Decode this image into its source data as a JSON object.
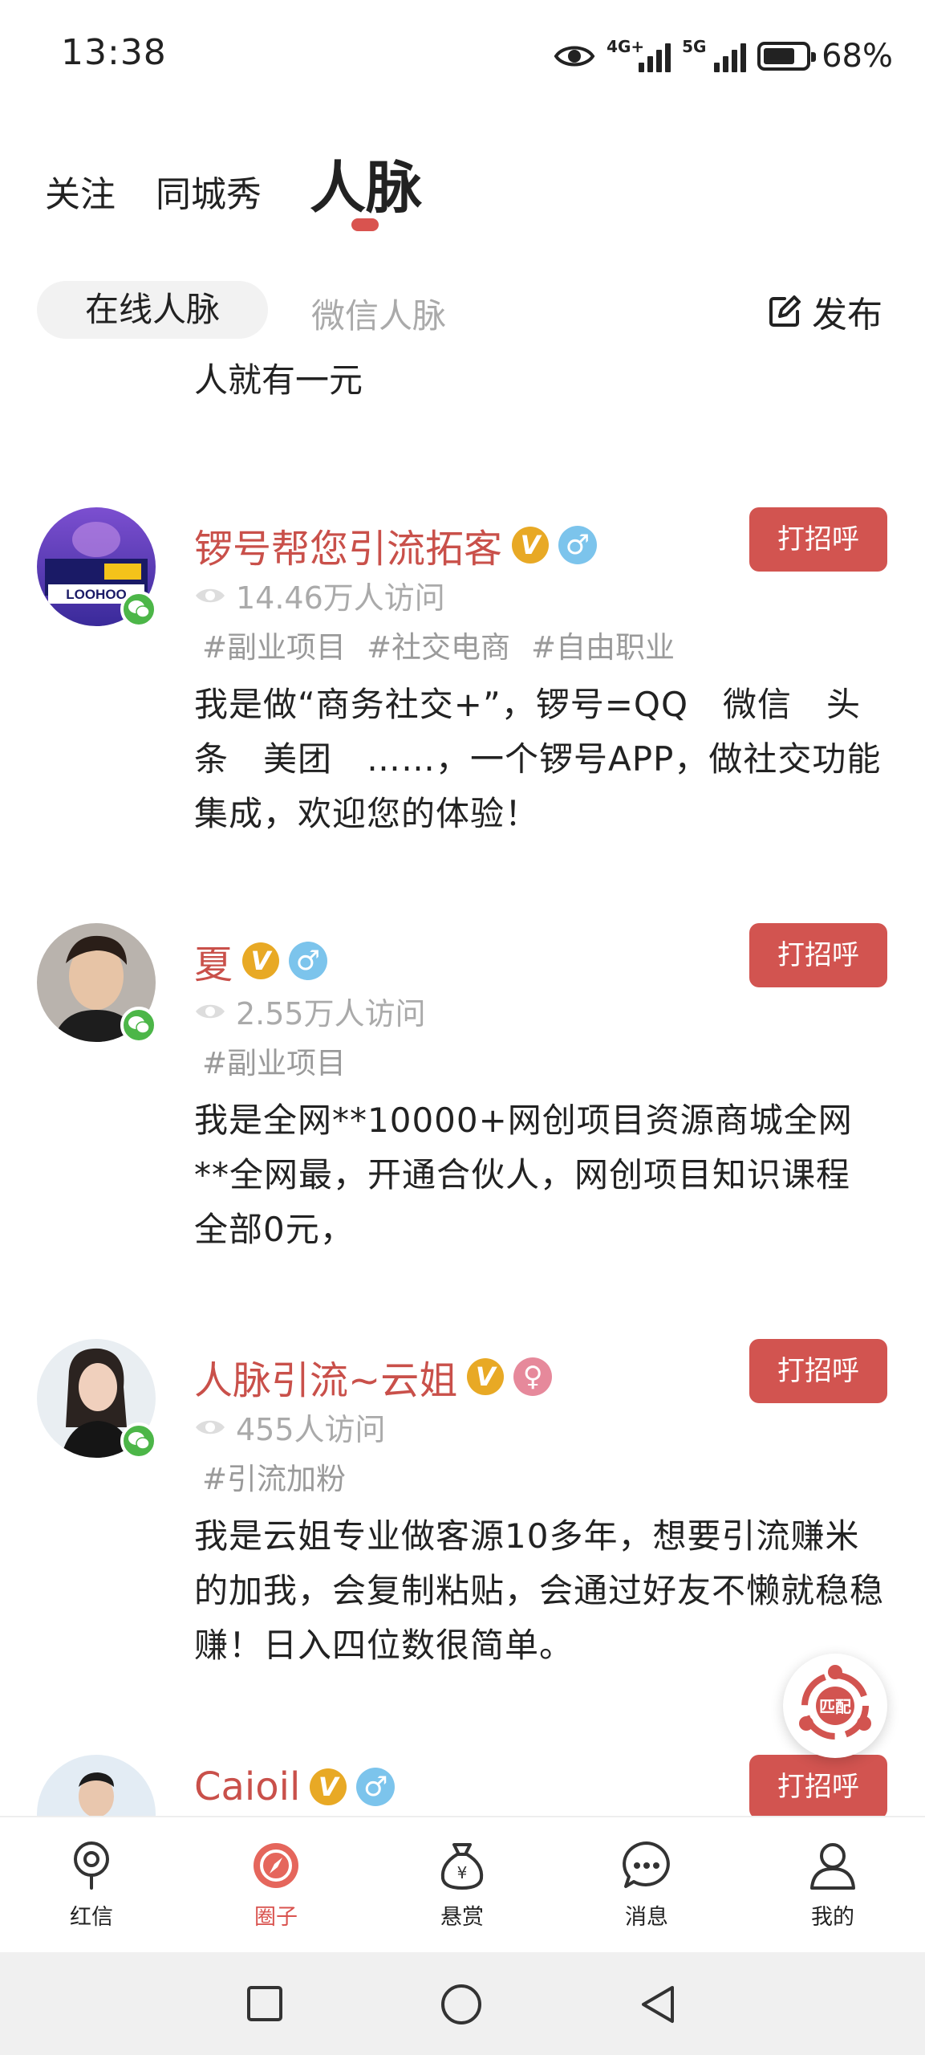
{
  "status_bar": {
    "time": "13:38",
    "network_1": "4G+",
    "network_2": "5G",
    "battery": "68%",
    "icons": [
      "eye-icon",
      "signal-icon",
      "battery-icon"
    ]
  },
  "top_tabs": [
    {
      "label": "关注"
    },
    {
      "label": "同城秀"
    },
    {
      "label": "人脉"
    }
  ],
  "sub_tabs": [
    {
      "label": "在线人脉"
    },
    {
      "label": "微信人脉"
    }
  ],
  "publish_label": "发布",
  "partial_text_line": "人就有一元",
  "greet_label": "打招呼",
  "match_label": "匹配",
  "cards": [
    {
      "name": "锣号帮您引流拓客",
      "visits": "14.46万人访问",
      "tags": [
        "#副业项目",
        "#社交电商",
        "#自由职业"
      ],
      "desc": "我是做“商务社交+”，锣号=QQ　微信　头条　美团　……，一个锣号APP，做社交功能集成，欢迎您的体验！",
      "gender": "male",
      "avatar_text": "LOOHOO"
    },
    {
      "name": "夏",
      "visits": "2.55万人访问",
      "tags": [
        "#副业项目"
      ],
      "desc": "我是全网**10000+网创项目资源商城全网**全网最，开通合伙人，网创项目知识课程全部0元，",
      "gender": "male"
    },
    {
      "name": "人脉引流~云姐",
      "visits": "455人访问",
      "tags": [
        "#引流加粉"
      ],
      "desc": "我是云姐专业做客源10多年，想要引流赚米的加我，会复制粘贴，会通过好友不懒就稳稳赚！日入四位数很简单。",
      "gender": "female"
    },
    {
      "name": "Caioil",
      "gender": "male"
    }
  ],
  "bottom_nav": [
    {
      "label": "红信",
      "icon": "location-pin-icon"
    },
    {
      "label": "圈子",
      "icon": "compass-icon"
    },
    {
      "label": "悬赏",
      "icon": "money-bag-icon"
    },
    {
      "label": "消息",
      "icon": "chat-bubble-icon"
    },
    {
      "label": "我的",
      "icon": "person-icon"
    }
  ],
  "colors": {
    "accent": "#d25450",
    "name": "#c9504a",
    "vip": "#e8a925",
    "male": "#7cc4ec",
    "female": "#e6899b",
    "wechat": "#4cb648"
  }
}
